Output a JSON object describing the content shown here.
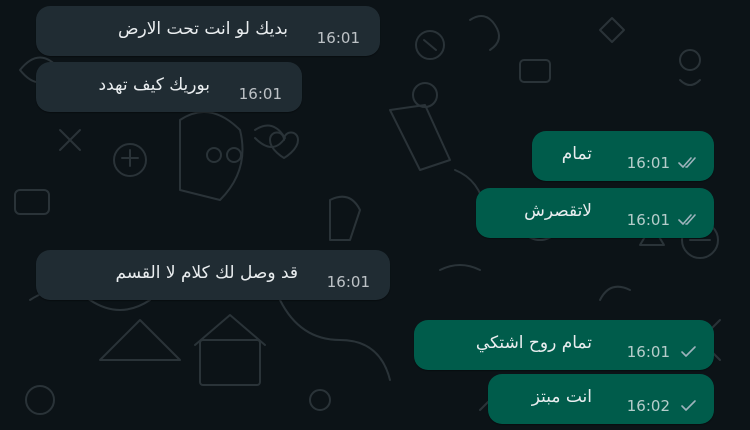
{
  "chat": {
    "messages": [
      {
        "direction": "incoming",
        "text": "بديك لو انت تحت الارض",
        "time": "16:01"
      },
      {
        "direction": "incoming",
        "text": "بوريك كيف تهدد",
        "time": "16:01"
      },
      {
        "direction": "outgoing",
        "text": "تمام",
        "time": "16:01",
        "status": "delivered",
        "status_icon": "double-check-icon"
      },
      {
        "direction": "outgoing",
        "text": "لاتقصرش",
        "time": "16:01",
        "status": "delivered",
        "status_icon": "double-check-icon"
      },
      {
        "direction": "incoming",
        "text": "قد وصل لك كلام لا القسم",
        "time": "16:01"
      },
      {
        "direction": "outgoing",
        "text": "تمام روح اشتكي",
        "time": "16:01",
        "status": "sent",
        "status_icon": "single-check-icon"
      },
      {
        "direction": "outgoing",
        "text": "انت مبتز",
        "time": "16:02",
        "status": "sent",
        "status_icon": "single-check-icon"
      }
    ]
  },
  "colors": {
    "background": "#0c1317",
    "incoming_bubble": "#202c33",
    "outgoing_bubble": "#005c4b",
    "text": "#e9edef"
  }
}
